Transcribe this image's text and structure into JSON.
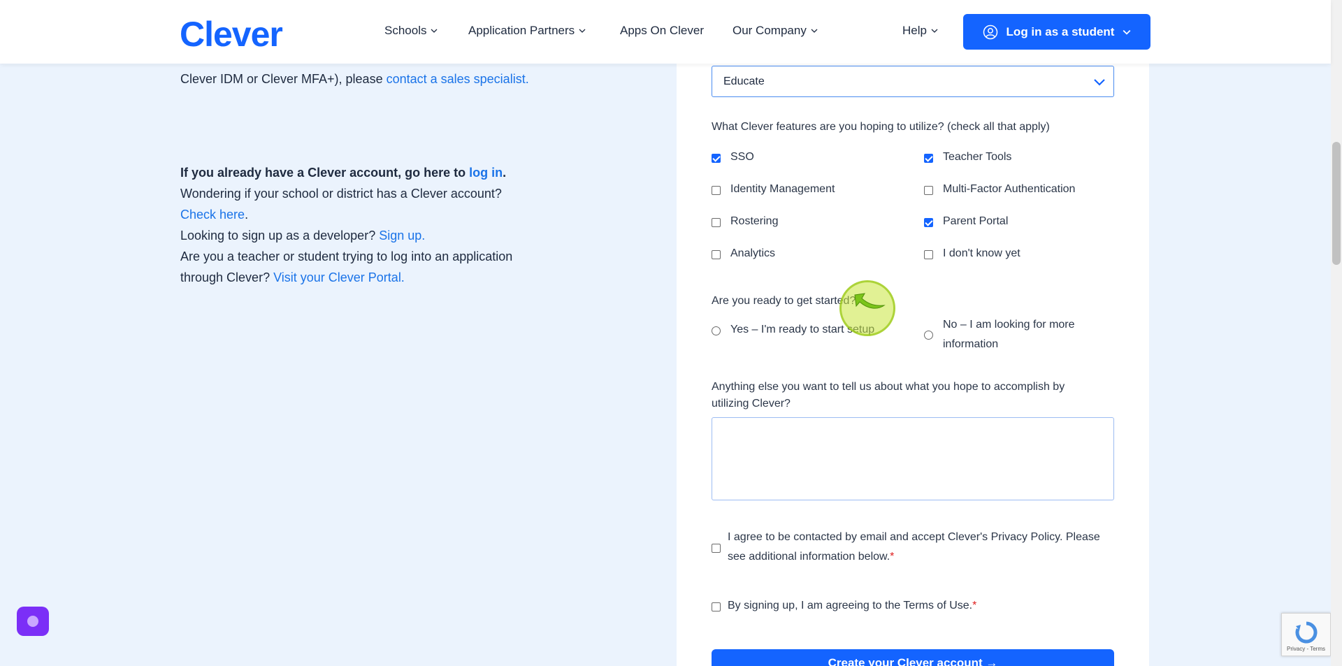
{
  "header": {
    "logo": "Clever",
    "nav": [
      {
        "label": "Schools",
        "has_dropdown": true
      },
      {
        "label": "Application Partners",
        "has_dropdown": true
      },
      {
        "label": "Apps On Clever",
        "has_dropdown": false
      },
      {
        "label": "Our Company",
        "has_dropdown": true
      },
      {
        "label": "Help",
        "has_dropdown": true
      }
    ],
    "login_button": "Log in as a student"
  },
  "left": {
    "intro_line": "Clever IDM or Clever MFA+), please ",
    "intro_link": "contact a sales specialist.",
    "account_text": "If you already have a Clever account, go here to ",
    "account_link": "log in",
    "account_end": ".",
    "wonder_text": "Wondering if your school or district has a Clever account?",
    "check_link": "Check here",
    "check_end": ".",
    "dev_text": "Looking to sign up as a developer? ",
    "dev_link": "Sign up.",
    "teacher_text": "Are you a teacher or student trying to log into an application",
    "through_text": "through Clever? ",
    "portal_link": "Visit your Clever Portal."
  },
  "form": {
    "select_value": "Educate",
    "features_question": "What Clever features are you hoping to utilize? (check all that apply)",
    "features": [
      {
        "label": "SSO",
        "checked": true
      },
      {
        "label": "Teacher Tools",
        "checked": true
      },
      {
        "label": "Identity Management",
        "checked": false
      },
      {
        "label": "Multi-Factor Authentication",
        "checked": false
      },
      {
        "label": "Rostering",
        "checked": false
      },
      {
        "label": "Parent Portal",
        "checked": true
      },
      {
        "label": "Analytics",
        "checked": false
      },
      {
        "label": "I don't know yet",
        "checked": false
      }
    ],
    "ready_question": "Are you ready to get started?",
    "ready_yes": "Yes – I'm ready to start setup",
    "ready_no_line1": "No – I am looking for more",
    "ready_no_line2": "information",
    "anything_line1": "Anything else you want to tell us about what you hope to accomplish by",
    "anything_line2": "utilizing Clever?",
    "privacy_line1": "I agree to be contacted by email and accept Clever's Privacy Policy. Please",
    "privacy_line2": "see additional information below.",
    "terms": "By signing up, I am agreeing to the Terms of Use.",
    "required_mark": "*",
    "submit": "Create your Clever account →"
  },
  "recaptcha": {
    "text": "Privacy - Terms"
  },
  "colors": {
    "brand": "#1464ff",
    "link": "#1a73e8",
    "page_bg": "#ebf3fd"
  }
}
